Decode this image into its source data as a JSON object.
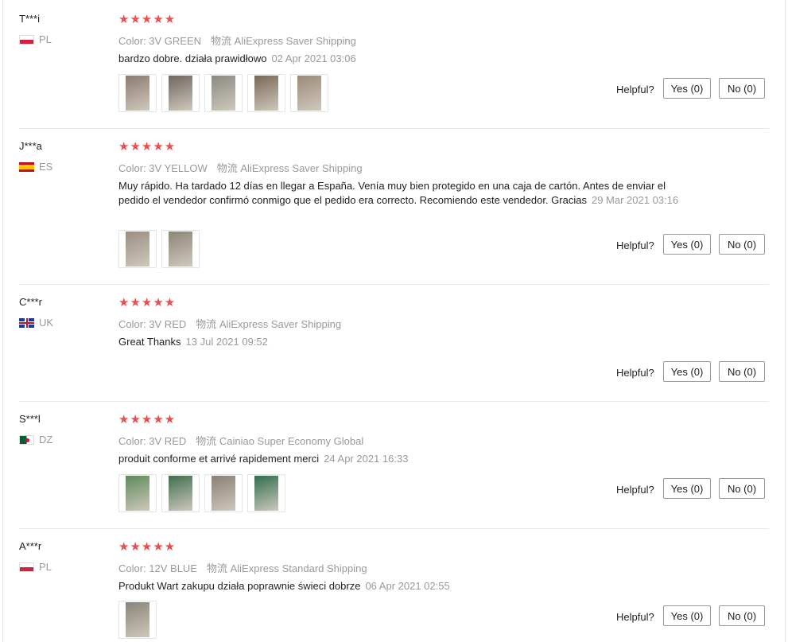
{
  "reviews": [
    {
      "user": "T***i",
      "country": "PL",
      "flag_icon": "poland-flag-icon",
      "stars": "★★★★★",
      "color": "Color: 3V GREEN",
      "shipping": "物流 AliExpress Saver Shipping",
      "text": "bardzo dobre. działa prawidłowo",
      "date": "02 Apr 2021 03:06",
      "photos": [
        "#8c7b70",
        "#6f6760",
        "#8a8a80",
        "#7a6656",
        "#9a8a78"
      ],
      "helpful": "Helpful?",
      "yes": "Yes (0)",
      "no": "No (0)"
    },
    {
      "user": "J***a",
      "country": "ES",
      "flag_icon": "spain-flag-icon",
      "stars": "★★★★★",
      "color": "Color: 3V YELLOW",
      "shipping": "物流 AliExpress Saver Shipping",
      "text": "Muy rápido. Ha tardado 12 días en llegar a España. Venía muy bien protegido en una caja de cartón. Antes de enviar el pedido el vendedor confirmó conmigo que el pedido era correcto. Recomiendo este vendedor. Gracias",
      "date": "29 Mar 2021 03:16",
      "photos": [
        "#9a8e80",
        "#8d8676"
      ],
      "helpful": "Helpful?",
      "yes": "Yes (0)",
      "no": "No (0)"
    },
    {
      "user": "C***r",
      "country": "UK",
      "flag_icon": "uk-flag-icon",
      "stars": "★★★★★",
      "color": "Color: 3V RED",
      "shipping": "物流 AliExpress Saver Shipping",
      "text": "Great Thanks",
      "date": "13 Jul 2021 09:52",
      "photos": [],
      "helpful": "Helpful?",
      "yes": "Yes (0)",
      "no": "No (0)"
    },
    {
      "user": "S***l",
      "country": "DZ",
      "flag_icon": "algeria-flag-icon",
      "stars": "★★★★★",
      "color": "Color: 3V RED",
      "shipping": "物流 Cainiao Super Economy Global",
      "text": "produit conforme et arrivé rapidement merci",
      "date": "24 Apr 2021 16:33",
      "photos": [
        "#5d8a5a",
        "#3f6e4c",
        "#8a7f74",
        "#2f6e4d"
      ],
      "helpful": "Helpful?",
      "yes": "Yes (0)",
      "no": "No (0)"
    },
    {
      "user": "A***r",
      "country": "PL",
      "flag_icon": "poland-flag-icon",
      "stars": "★★★★★",
      "color": "Color: 12V BLUE",
      "shipping": "物流 AliExpress Standard Shipping",
      "text": "Produkt Wart zakupu działa poprawnie świeci dobrze",
      "date": "06 Apr 2021 02:55",
      "photos": [
        "#8a8478"
      ],
      "helpful": "Helpful?",
      "yes": "Yes (0)",
      "no": "No (0)"
    }
  ]
}
